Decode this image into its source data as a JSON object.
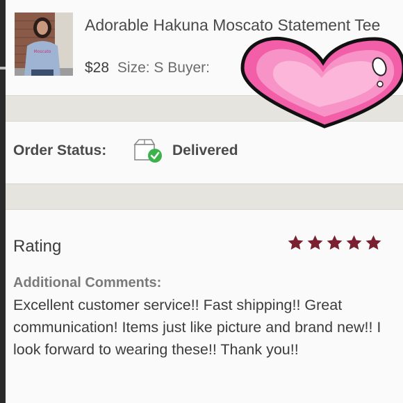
{
  "product": {
    "title": "Adorable Hakuna Moscato Statement Tee",
    "price": "$28",
    "size": "Size: S",
    "buyer_label": "Buyer:",
    "thumbnail": "product-thumbnail-woman-in-tee"
  },
  "order": {
    "status_label": "Order Status:",
    "status_value": "Delivered",
    "status_icon": "box-delivered-check-icon"
  },
  "rating": {
    "label": "Rating",
    "stars": 5,
    "star_color": "#7a2131",
    "comments_label": "Additional Comments:",
    "comments": "Excellent customer service!! Fast shipping!! Great communication! Items just like picture and brand new!! I look forward to wearing these!! Thank you!!"
  },
  "overlay": {
    "sticker": "pink-heart-sticker",
    "color": "#f25ea8"
  }
}
